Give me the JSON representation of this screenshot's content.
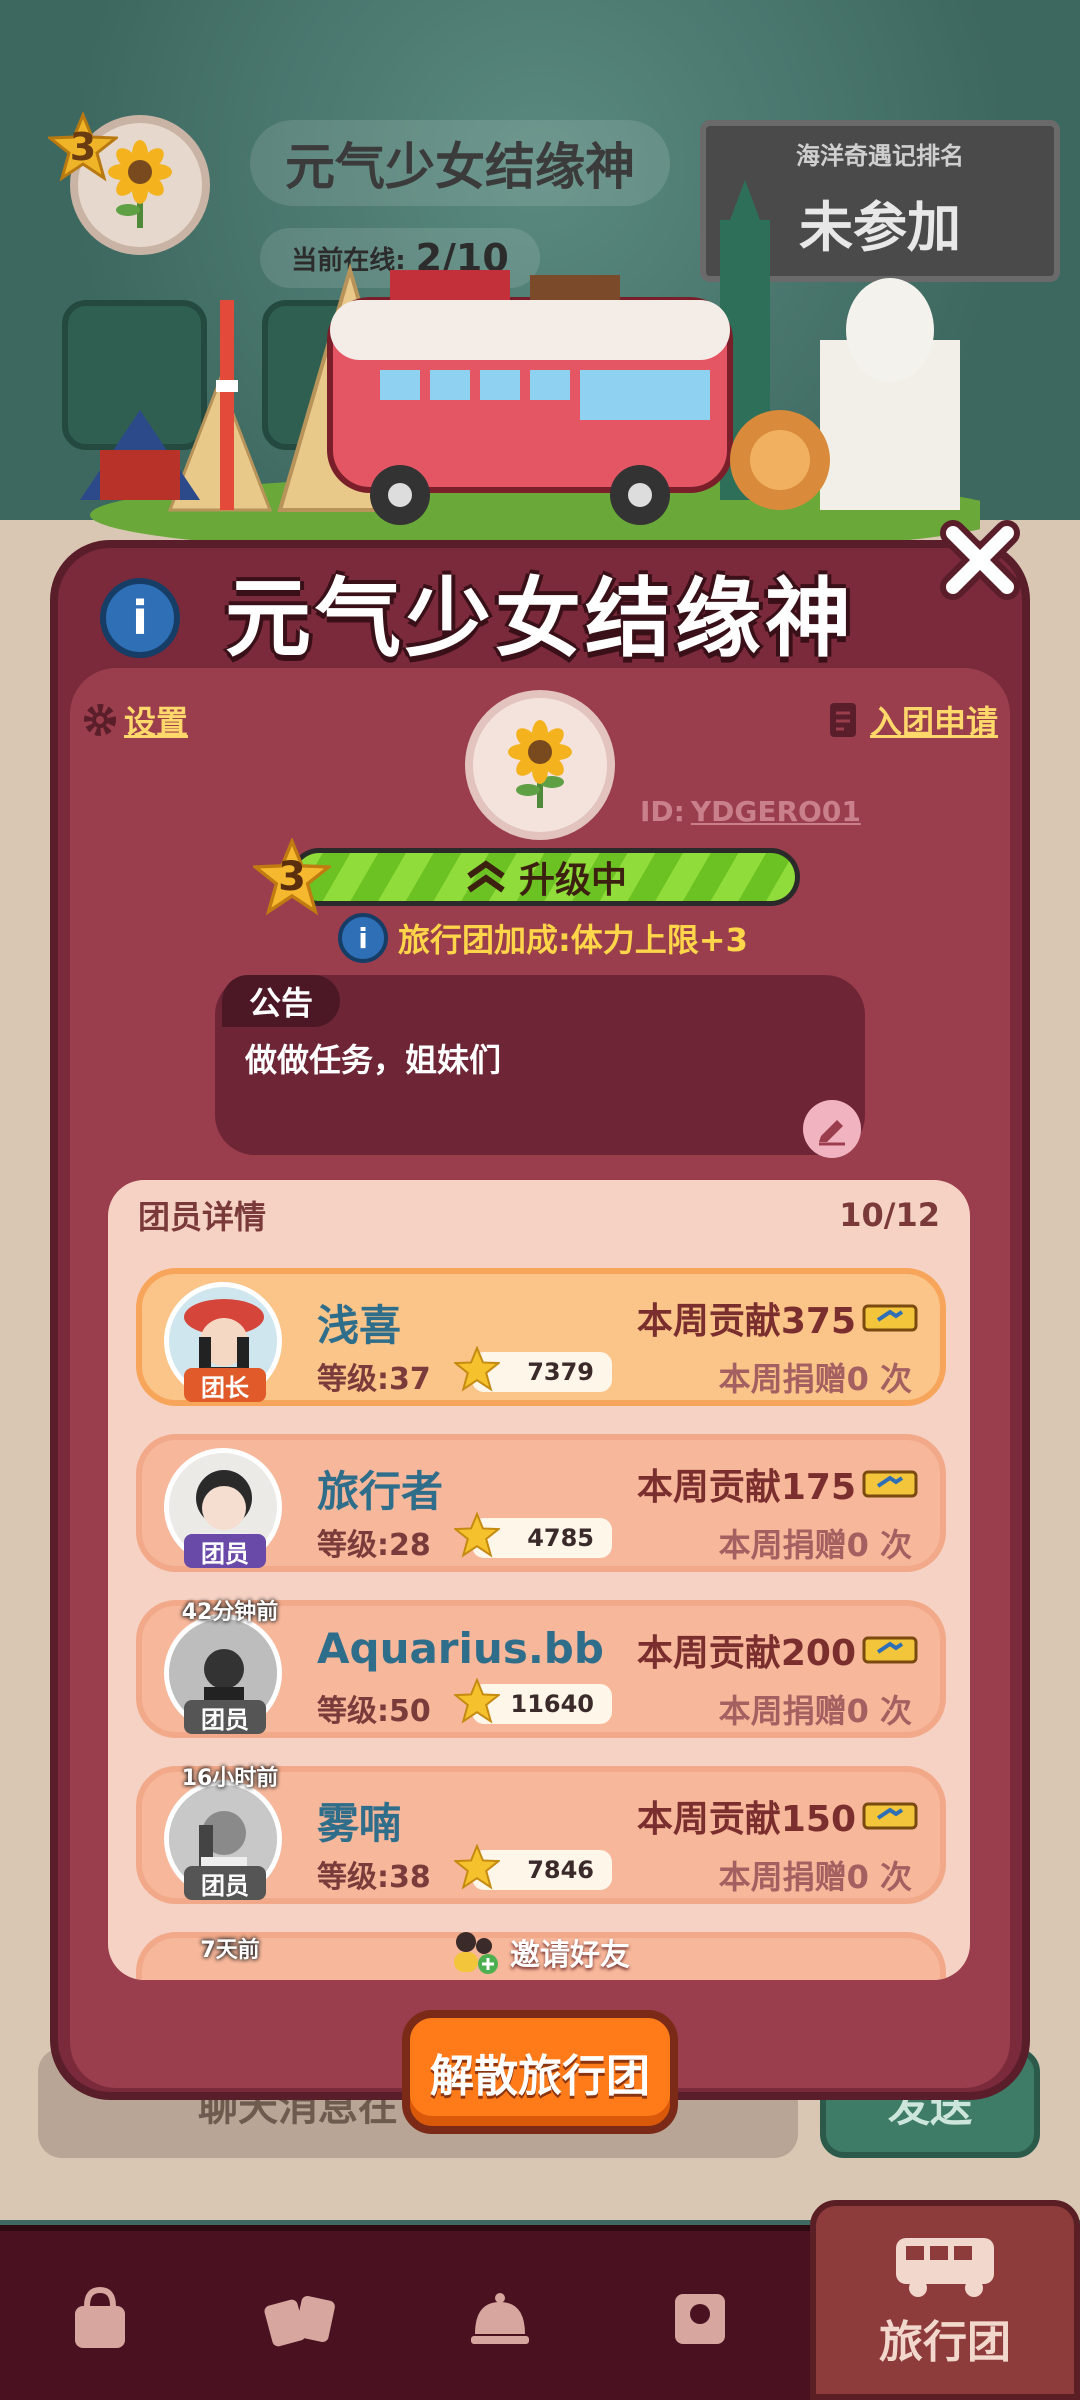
{
  "background": {
    "group_title": "元气少女结缘神",
    "level": "3",
    "online_label": "当前在线:",
    "online_value": "2/10",
    "rank_board_title": "海洋奇遇记排名",
    "rank_board_value": "未参加",
    "chat_placeholder": "聊天消息在",
    "send_label": "发送"
  },
  "modal": {
    "title": "元气少女结缘神",
    "settings_label": "设置",
    "apply_label": "入团申请",
    "group_id_label": "ID:",
    "group_id_value": "YDGERO01",
    "level": "3",
    "level_status": "升级中",
    "level_progress": 1.0,
    "bonus_text": "旅行团加成:体力上限+3",
    "notice_tab": "公告",
    "notice_text": "做做任务，姐妹们",
    "members_title": "团员详情",
    "members_count": "10/12",
    "members": [
      {
        "name": "浅喜",
        "role": "团长",
        "level": "等级:37",
        "points": "7379",
        "contribution": "本周贡献375",
        "donation": "本周捐赠0 次",
        "last_seen": ""
      },
      {
        "name": "旅行者",
        "role": "团员",
        "level": "等级:28",
        "points": "4785",
        "contribution": "本周贡献175",
        "donation": "本周捐赠0 次",
        "last_seen": ""
      },
      {
        "name": "Aquarius.bb",
        "role": "团员",
        "level": "等级:50",
        "points": "11640",
        "contribution": "本周贡献200",
        "donation": "本周捐赠0 次",
        "last_seen": "42分钟前"
      },
      {
        "name": "雾喃",
        "role": "团员",
        "level": "等级:38",
        "points": "7846",
        "contribution": "本周贡献150",
        "donation": "本周捐赠0 次",
        "last_seen": "16小时前"
      }
    ],
    "partial_last_seen": "7天前",
    "invite_label": "邀请好友",
    "disband_label": "解散旅行团"
  },
  "bottom_nav": {
    "active_label": "旅行团"
  },
  "colors": {
    "modal_bg": "#9a3d4d",
    "accent_yellow": "#ffd54a",
    "disband_orange": "#ff7b1a",
    "progress_green": "#8fdc3a"
  }
}
